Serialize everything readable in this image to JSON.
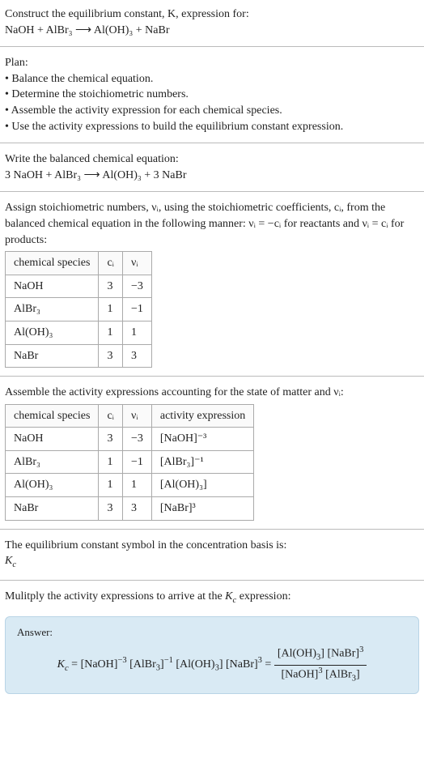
{
  "header": {
    "prompt": "Construct the equilibrium constant, K, expression for:",
    "reaction": "NaOH + AlBr₃  ⟶  Al(OH)₃ + NaBr"
  },
  "plan": {
    "title": "Plan:",
    "items": [
      "• Balance the chemical equation.",
      "• Determine the stoichiometric numbers.",
      "• Assemble the activity expression for each chemical species.",
      "• Use the activity expressions to build the equilibrium constant expression."
    ]
  },
  "balanced": {
    "label": "Write the balanced chemical equation:",
    "reaction": "3 NaOH + AlBr₃  ⟶  Al(OH)₃ + 3 NaBr"
  },
  "stoich": {
    "intro": "Assign stoichiometric numbers, νᵢ, using the stoichiometric coefficients, cᵢ, from the balanced chemical equation in the following manner: νᵢ = −cᵢ for reactants and νᵢ = cᵢ for products:",
    "headers": [
      "chemical species",
      "cᵢ",
      "νᵢ"
    ],
    "rows": [
      {
        "species": "NaOH",
        "c": "3",
        "v": "−3"
      },
      {
        "species": "AlBr₃",
        "c": "1",
        "v": "−1"
      },
      {
        "species": "Al(OH)₃",
        "c": "1",
        "v": "1"
      },
      {
        "species": "NaBr",
        "c": "3",
        "v": "3"
      }
    ]
  },
  "activity": {
    "intro": "Assemble the activity expressions accounting for the state of matter and νᵢ:",
    "headers": [
      "chemical species",
      "cᵢ",
      "νᵢ",
      "activity expression"
    ],
    "rows": [
      {
        "species": "NaOH",
        "c": "3",
        "v": "−3",
        "expr": "[NaOH]⁻³"
      },
      {
        "species": "AlBr₃",
        "c": "1",
        "v": "−1",
        "expr": "[AlBr₃]⁻¹"
      },
      {
        "species": "Al(OH)₃",
        "c": "1",
        "v": "1",
        "expr": "[Al(OH)₃]"
      },
      {
        "species": "NaBr",
        "c": "3",
        "v": "3",
        "expr": "[NaBr]³"
      }
    ]
  },
  "symbol": {
    "line": "The equilibrium constant symbol in the concentration basis is:",
    "kc": "K_c"
  },
  "multiply": {
    "line": "Mulitply the activity expressions to arrive at the K_c expression:"
  },
  "answer": {
    "label": "Answer:",
    "lhs": "K_c = [NaOH]⁻³ [AlBr₃]⁻¹ [Al(OH)₃] [NaBr]³ = ",
    "frac_num": "[Al(OH)₃] [NaBr]³",
    "frac_den": "[NaOH]³ [AlBr₃]"
  }
}
